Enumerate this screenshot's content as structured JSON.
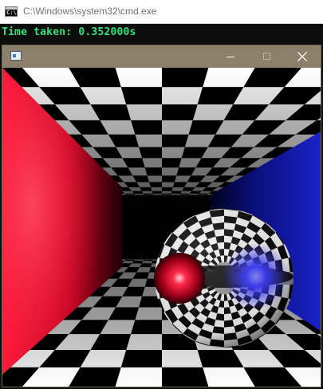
{
  "console": {
    "title": "C:\\Windows\\system32\\cmd.exe",
    "output_line": "Time taken: 0.352000s",
    "text_color": "#36e07a",
    "background": "#0c0c0c"
  },
  "render_window": {
    "title": "",
    "titlebar_color": "#8d806a",
    "icons": {
      "app": "window-app-icon",
      "minimize": "minimize-icon",
      "maximize": "maximize-icon",
      "close": "close-icon"
    },
    "scene": {
      "left_wall_color": "#ff1a3a",
      "right_wall_color": "#1020d0",
      "checker_dark": "#000000",
      "checker_light": "#ffffff",
      "sphere_highlight_red": "#ff2a4a",
      "sphere_highlight_blue": "#3a3aff"
    }
  }
}
